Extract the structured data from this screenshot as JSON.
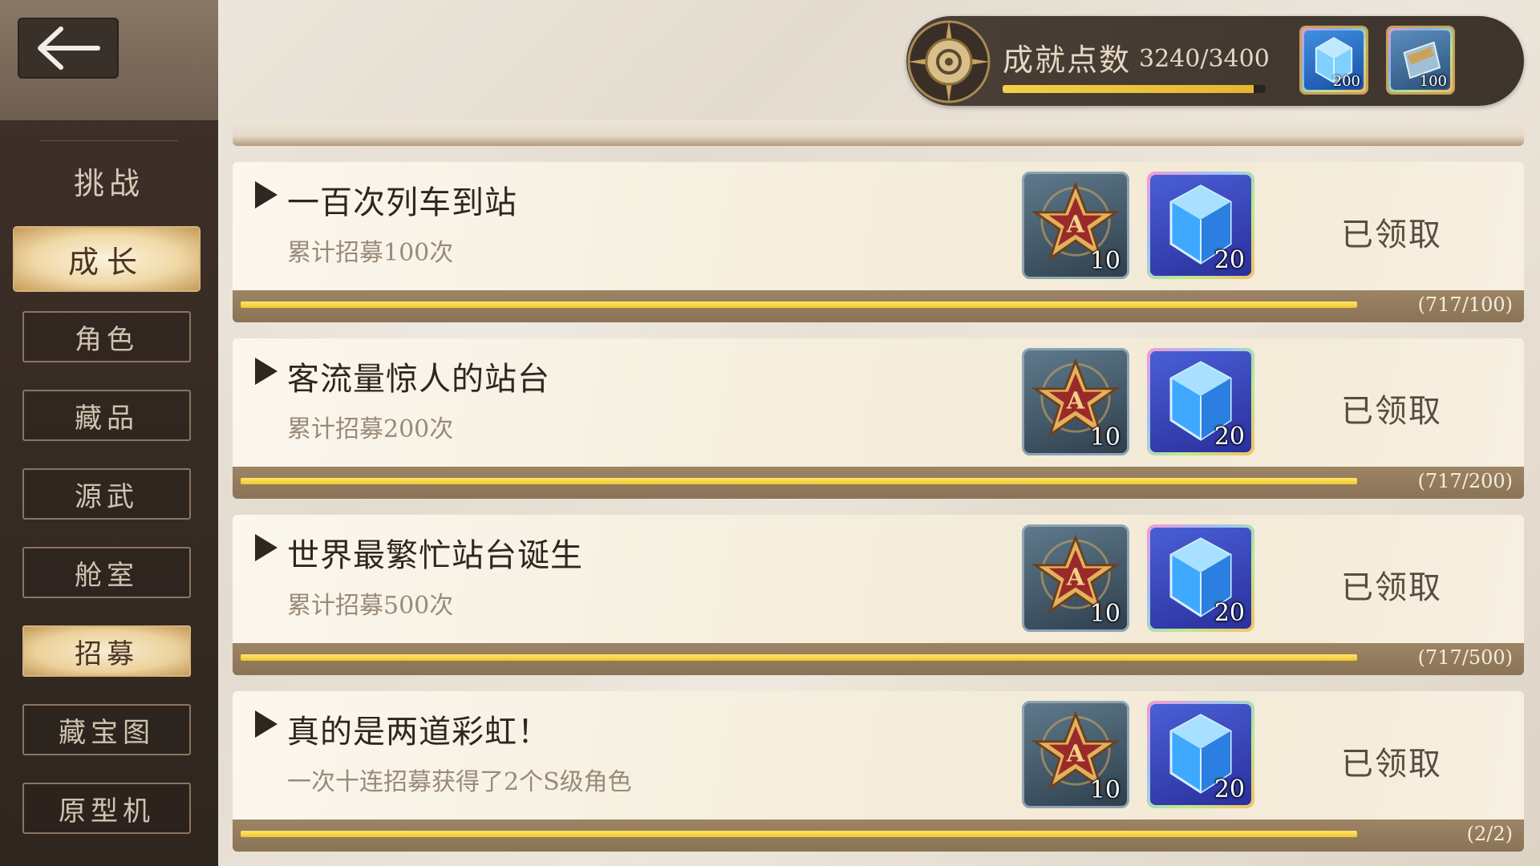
{
  "sidebar": {
    "section_title": "挑战",
    "active_tab": "成长",
    "items": [
      {
        "label": "角色",
        "selected": false
      },
      {
        "label": "藏品",
        "selected": false
      },
      {
        "label": "源武",
        "selected": false
      },
      {
        "label": "舱室",
        "selected": false
      },
      {
        "label": "招募",
        "selected": true
      },
      {
        "label": "藏宝图",
        "selected": false
      },
      {
        "label": "原型机",
        "selected": false
      }
    ]
  },
  "header": {
    "label": "成就点数",
    "value": "3240/3400",
    "progress": 0.953,
    "chests": [
      {
        "icon": "crystal-chest-icon",
        "count": "200"
      },
      {
        "icon": "treasure-chest-icon",
        "count": "100"
      }
    ]
  },
  "achievements": [
    {
      "title": "一百次列车到站",
      "desc": "累计招募100次",
      "rewards": [
        {
          "icon": "a-rank-badge-icon",
          "count": "10"
        },
        {
          "icon": "blue-crystal-icon",
          "count": "20"
        }
      ],
      "status": "已领取",
      "progress_text": "(717/100)",
      "progress": 1.0
    },
    {
      "title": "客流量惊人的站台",
      "desc": "累计招募200次",
      "rewards": [
        {
          "icon": "a-rank-badge-icon",
          "count": "10"
        },
        {
          "icon": "blue-crystal-icon",
          "count": "20"
        }
      ],
      "status": "已领取",
      "progress_text": "(717/200)",
      "progress": 1.0
    },
    {
      "title": "世界最繁忙站台诞生",
      "desc": "累计招募500次",
      "rewards": [
        {
          "icon": "a-rank-badge-icon",
          "count": "10"
        },
        {
          "icon": "blue-crystal-icon",
          "count": "20"
        }
      ],
      "status": "已领取",
      "progress_text": "(717/500)",
      "progress": 1.0
    },
    {
      "title": "真的是两道彩虹！",
      "desc": "一次十连招募获得了2个S级角色",
      "rewards": [
        {
          "icon": "a-rank-badge-icon",
          "count": "10"
        },
        {
          "icon": "blue-crystal-icon",
          "count": "20"
        }
      ],
      "status": "已领取",
      "progress_text": "(2/2)",
      "progress": 1.0
    }
  ],
  "colors": {
    "progress_fill": "#f0c72a",
    "sidebar_bg": "#2f2620",
    "active_tab": "#f0d9a6"
  }
}
